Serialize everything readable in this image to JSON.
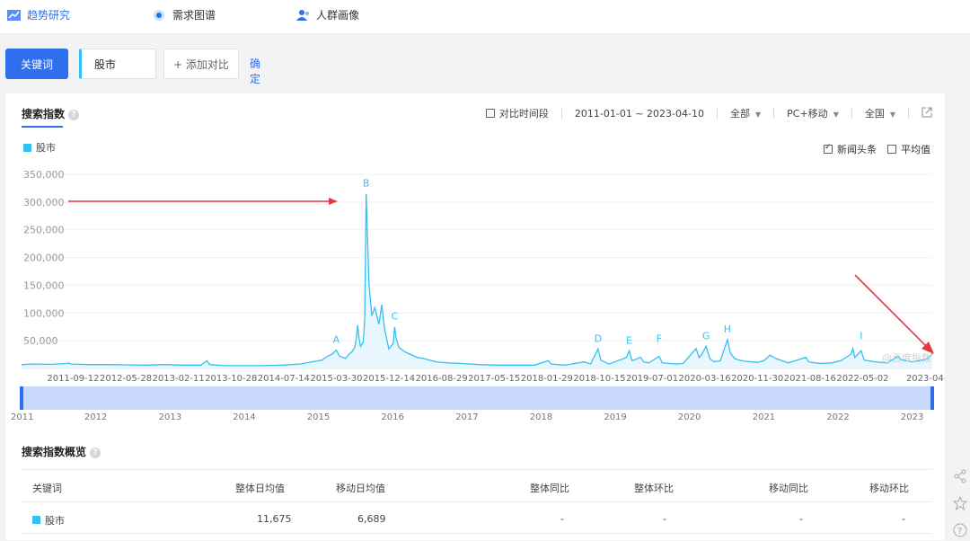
{
  "nav": {
    "items": [
      {
        "label": "趋势研究",
        "icon": "trend-icon",
        "active": true
      },
      {
        "label": "需求图谱",
        "icon": "demand-graph-icon",
        "active": false
      },
      {
        "label": "人群画像",
        "icon": "people-icon",
        "active": false
      }
    ]
  },
  "toolbar": {
    "keyword_label": "关键词",
    "keyword_value": "股市",
    "add_compare": "+ 添加对比",
    "confirm": "确定"
  },
  "panel": {
    "title": "搜索指数",
    "compare_period": "对比时间段",
    "date_range": "2011-01-01 ~ 2023-04-10",
    "scope": "全部",
    "device": "PC+移动",
    "region": "全国",
    "news_headlines": "新闻头条",
    "average": "平均值",
    "watermark": "@百度指数"
  },
  "colors": {
    "accent": "#2f6fed",
    "series": "#36c0f0",
    "series_fill": "#e8f7fd",
    "annotation_arrow": "#e4393c"
  },
  "chart_data": {
    "type": "area",
    "legend": [
      "股市"
    ],
    "ylim": [
      0,
      350000
    ],
    "yticks": [
      "350,000",
      "300,000",
      "250,000",
      "200,000",
      "150,000",
      "100,000",
      "50,000"
    ],
    "ytick_values": [
      350000,
      300000,
      250000,
      200000,
      150000,
      100000,
      50000
    ],
    "xticks": [
      "2011-09-12",
      "2012-05-28",
      "2013-02-11",
      "2013-10-28",
      "2014-07-14",
      "2015-03-30",
      "2015-12-14",
      "2016-08-29",
      "2017-05-15",
      "2018-01-29",
      "2018-10-15",
      "2019-07-01",
      "2020-03-16",
      "2020-11-30",
      "2021-08-16",
      "2022-05-02",
      "2023-04-10"
    ],
    "xlim": [
      "2011-01-01",
      "2023-04-10"
    ],
    "series": [
      {
        "name": "股市",
        "points": [
          [
            "2011-01-01",
            7000
          ],
          [
            "2011-03-01",
            8000
          ],
          [
            "2011-06-01",
            7500
          ],
          [
            "2011-08-15",
            9000
          ],
          [
            "2011-08-22",
            10000
          ],
          [
            "2011-09-01",
            8000
          ],
          [
            "2011-12-01",
            7000
          ],
          [
            "2012-03-01",
            7000
          ],
          [
            "2012-06-01",
            6500
          ],
          [
            "2012-09-01",
            6000
          ],
          [
            "2012-12-01",
            7000
          ],
          [
            "2013-03-01",
            6000
          ],
          [
            "2013-06-01",
            6000
          ],
          [
            "2013-06-24",
            12000
          ],
          [
            "2013-07-01",
            14000
          ],
          [
            "2013-07-15",
            7000
          ],
          [
            "2013-10-01",
            5000
          ],
          [
            "2014-01-01",
            5000
          ],
          [
            "2014-04-01",
            5000
          ],
          [
            "2014-07-01",
            6000
          ],
          [
            "2014-10-01",
            8000
          ],
          [
            "2014-12-01",
            12000
          ],
          [
            "2015-01-19",
            15000
          ],
          [
            "2015-02-15",
            22000
          ],
          [
            "2015-03-10",
            26000
          ],
          [
            "2015-03-30",
            33000
          ],
          [
            "2015-04-15",
            22000
          ],
          [
            "2015-05-15",
            18000
          ],
          [
            "2015-06-01",
            26000
          ],
          [
            "2015-06-15",
            30000
          ],
          [
            "2015-06-29",
            38000
          ],
          [
            "2015-07-06",
            52000
          ],
          [
            "2015-07-13",
            78000
          ],
          [
            "2015-07-20",
            55000
          ],
          [
            "2015-07-27",
            40000
          ],
          [
            "2015-08-10",
            48000
          ],
          [
            "2015-08-17",
            90000
          ],
          [
            "2015-08-24",
            315000
          ],
          [
            "2015-08-31",
            230000
          ],
          [
            "2015-09-07",
            150000
          ],
          [
            "2015-09-21",
            95000
          ],
          [
            "2015-10-05",
            110000
          ],
          [
            "2015-10-12",
            100000
          ],
          [
            "2015-10-26",
            80000
          ],
          [
            "2015-11-09",
            115000
          ],
          [
            "2015-11-23",
            70000
          ],
          [
            "2015-12-14",
            35000
          ],
          [
            "2016-01-04",
            45000
          ],
          [
            "2016-01-11",
            75000
          ],
          [
            "2016-01-18",
            55000
          ],
          [
            "2016-02-01",
            38000
          ],
          [
            "2016-03-01",
            30000
          ],
          [
            "2016-04-01",
            25000
          ],
          [
            "2016-05-01",
            20000
          ],
          [
            "2016-06-01",
            18000
          ],
          [
            "2016-07-01",
            15000
          ],
          [
            "2016-08-01",
            12000
          ],
          [
            "2016-10-01",
            10000
          ],
          [
            "2016-12-01",
            9000
          ],
          [
            "2017-03-01",
            7000
          ],
          [
            "2017-06-01",
            6000
          ],
          [
            "2017-09-01",
            6000
          ],
          [
            "2017-12-01",
            6000
          ],
          [
            "2018-02-05",
            14000
          ],
          [
            "2018-02-20",
            8000
          ],
          [
            "2018-05-01",
            6000
          ],
          [
            "2018-07-01",
            10000
          ],
          [
            "2018-08-01",
            12000
          ],
          [
            "2018-09-01",
            8000
          ],
          [
            "2018-10-08",
            35000
          ],
          [
            "2018-10-22",
            15000
          ],
          [
            "2018-12-01",
            8000
          ],
          [
            "2019-02-25",
            20000
          ],
          [
            "2019-03-10",
            32000
          ],
          [
            "2019-03-25",
            14000
          ],
          [
            "2019-05-06",
            20000
          ],
          [
            "2019-05-20",
            12000
          ],
          [
            "2019-06-15",
            10000
          ],
          [
            "2019-08-05",
            22000
          ],
          [
            "2019-08-20",
            10000
          ],
          [
            "2019-11-01",
            8000
          ],
          [
            "2019-12-01",
            9000
          ],
          [
            "2020-02-03",
            36000
          ],
          [
            "2020-02-17",
            20000
          ],
          [
            "2020-03-01",
            25000
          ],
          [
            "2020-03-23",
            40000
          ],
          [
            "2020-04-10",
            18000
          ],
          [
            "2020-05-01",
            12000
          ],
          [
            "2020-06-01",
            14000
          ],
          [
            "2020-07-06",
            52000
          ],
          [
            "2020-07-20",
            28000
          ],
          [
            "2020-08-10",
            18000
          ],
          [
            "2020-09-01",
            15000
          ],
          [
            "2020-10-01",
            13000
          ],
          [
            "2020-12-01",
            11000
          ],
          [
            "2021-01-01",
            14000
          ],
          [
            "2021-02-01",
            24000
          ],
          [
            "2021-03-01",
            18000
          ],
          [
            "2021-05-01",
            10000
          ],
          [
            "2021-07-26",
            20000
          ],
          [
            "2021-08-10",
            12000
          ],
          [
            "2021-10-01",
            9000
          ],
          [
            "2021-12-01",
            10000
          ],
          [
            "2022-01-15",
            14000
          ],
          [
            "2022-03-07",
            26000
          ],
          [
            "2022-03-15",
            36000
          ],
          [
            "2022-03-25",
            20000
          ],
          [
            "2022-04-25",
            32000
          ],
          [
            "2022-05-10",
            15000
          ],
          [
            "2022-07-01",
            12000
          ],
          [
            "2022-09-01",
            10000
          ],
          [
            "2022-10-24",
            22000
          ],
          [
            "2022-11-07",
            16000
          ],
          [
            "2023-01-01",
            12000
          ],
          [
            "2023-02-01",
            14000
          ],
          [
            "2023-03-01",
            16000
          ],
          [
            "2023-03-20",
            18000
          ],
          [
            "2023-04-10",
            27000
          ]
        ]
      }
    ],
    "annotations": [
      {
        "label": "A",
        "date": "2015-03-30",
        "value": 33000
      },
      {
        "label": "B",
        "date": "2015-08-24",
        "value": 315000
      },
      {
        "label": "C",
        "date": "2016-01-11",
        "value": 75000
      },
      {
        "label": "D",
        "date": "2018-10-08",
        "value": 35000
      },
      {
        "label": "E",
        "date": "2019-03-10",
        "value": 32000
      },
      {
        "label": "F",
        "date": "2019-08-05",
        "value": 35000
      },
      {
        "label": "G",
        "date": "2020-03-23",
        "value": 40000
      },
      {
        "label": "H",
        "date": "2020-07-06",
        "value": 52000
      },
      {
        "label": "I",
        "date": "2022-04-25",
        "value": 40000
      }
    ],
    "range_years": [
      "2011",
      "2012",
      "2013",
      "2014",
      "2015",
      "2016",
      "2017",
      "2018",
      "2019",
      "2020",
      "2021",
      "2022",
      "2023"
    ]
  },
  "overview": {
    "title": "搜索指数概览",
    "headers": [
      "关键词",
      "整体日均值",
      "移动日均值",
      "整体同比",
      "整体环比",
      "移动同比",
      "移动环比"
    ],
    "rows": [
      {
        "keyword": "股市",
        "overall_avg": "11,675",
        "mobile_avg": "6,689",
        "overall_yoy": "-",
        "overall_mom": "-",
        "mobile_yoy": "-",
        "mobile_mom": "-"
      }
    ]
  }
}
